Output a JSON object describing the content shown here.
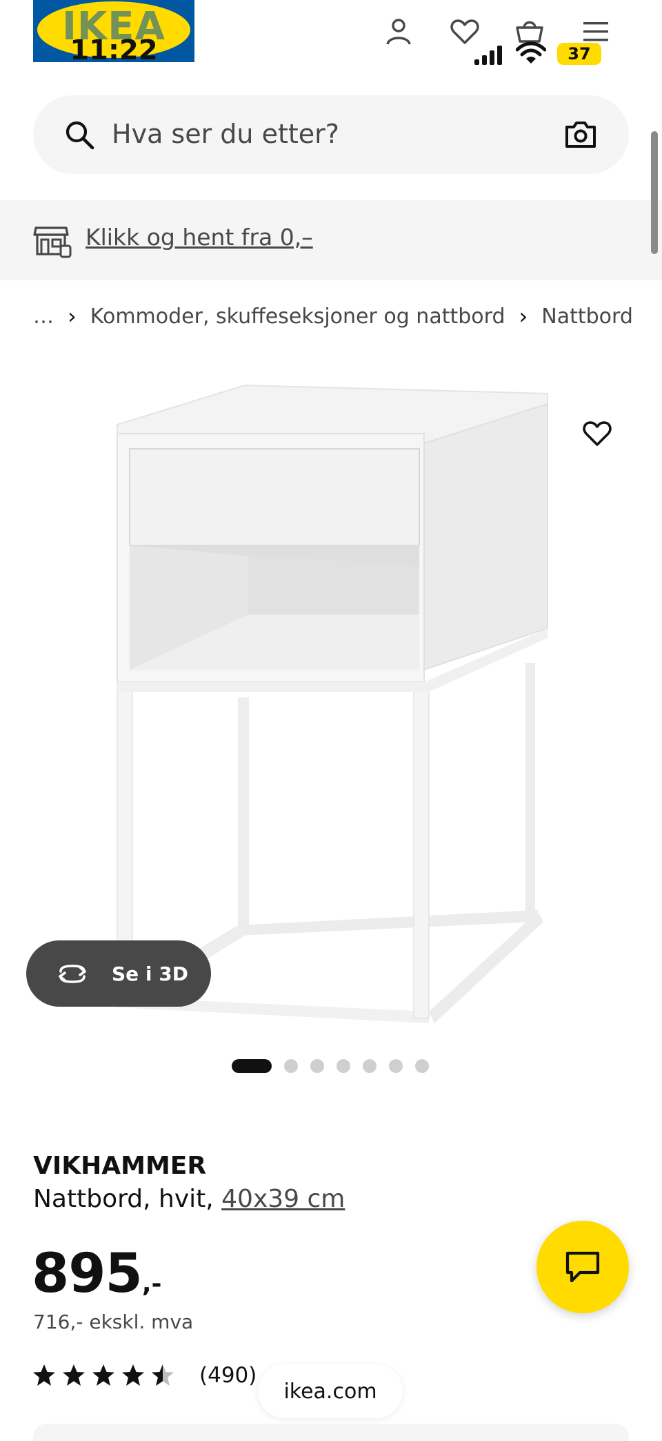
{
  "header": {
    "logo_text": "IKEA",
    "clock": "11:22",
    "battery": "37",
    "icons": [
      "user-icon",
      "heart-icon",
      "basket-icon",
      "menu-icon"
    ]
  },
  "search": {
    "placeholder": "Hva ser du etter?",
    "icons": [
      "search-icon",
      "camera-icon"
    ]
  },
  "banner": {
    "link": "Klikk og hent fra 0,–",
    "icon": "store-icon"
  },
  "breadcrumb": {
    "items": [
      "…",
      "Kommoder, skuffeseksjoner og nattbord",
      "Nattbord"
    ]
  },
  "gallery": {
    "view_3d_label": "Se i 3D",
    "slide_count": 7,
    "active_slide": 1
  },
  "product": {
    "name": "VIKHAMMER",
    "description": "Nattbord, hvit, ",
    "size": "40x39 cm",
    "price_whole": "895",
    "price_suffix": ",-",
    "price_excl_vat": "716,- ekskl. mva",
    "rating_stars": 4.5,
    "rating_count": "(490)"
  },
  "browser": {
    "url": "ikea.com"
  },
  "colors": {
    "ikea_yellow": "#ffdb00",
    "ikea_blue": "#0058a3",
    "text": "#111111",
    "muted_text": "#484848",
    "panel_grey": "#f5f5f5"
  }
}
